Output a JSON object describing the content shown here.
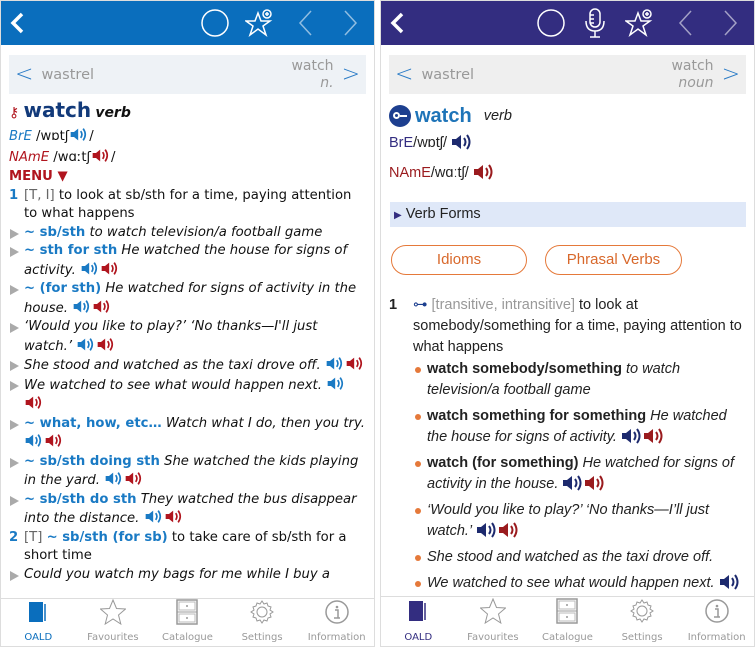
{
  "colors": {
    "left_header": "#0a6ebd",
    "right_header": "#332d80",
    "link_blue": "#1a7ac4",
    "name_red": "#b0151e",
    "accent_orange": "#e5793a"
  },
  "left": {
    "nav": {
      "prev": "wastrel",
      "next_word": "watch",
      "next_pos": "n."
    },
    "headword": "watch",
    "pos": "verb",
    "bre_label": "BrE",
    "bre_pron": "/wɒtʃ",
    "nam_label": "NAmE",
    "nam_pron": "/wɑːtʃ",
    "slash": "/",
    "menu": "MENU ▼",
    "sense1": {
      "num": "1",
      "grammar": "[T, I]",
      "def": "to look at sb/sth for a time, paying attention to what happens"
    },
    "examples": [
      {
        "pattern": "~ sb/sth",
        "text": "to watch television/a football game"
      },
      {
        "pattern": "~ sth for sth",
        "text": "He watched the house for signs of activity."
      },
      {
        "pattern": "~ (for sth)",
        "text": "He watched for signs of activity in the house."
      },
      {
        "pattern": "",
        "text": "‘Would you like to play?’ ‘No thanks—I'll just watch.’"
      },
      {
        "pattern": "",
        "text": "She stood and watched as the taxi drove off."
      },
      {
        "pattern": "",
        "text": "We watched to see what would happen next."
      },
      {
        "pattern": "~ what, how, etc…",
        "text": "Watch what I do, then you try."
      },
      {
        "pattern": "~ sb/sth doing sth",
        "text": "She watched the kids playing in the yard."
      },
      {
        "pattern": "~ sb/sth do sth",
        "text": "They watched the bus disappear into the distance."
      }
    ],
    "sense2": {
      "num": "2",
      "grammar": "[T]",
      "pattern": "~ sb/sth (for sb)",
      "def": "to take care of sb/sth for a short time"
    },
    "sense2_example": "Could you watch my bags for me while I buy a"
  },
  "right": {
    "nav": {
      "prev": "wastrel",
      "next_word": "watch",
      "next_pos": "noun"
    },
    "headword": "watch",
    "pos": "verb",
    "bre_label": "BrE",
    "bre_pron": "/wɒtʃ/",
    "nam_label": "NAmE",
    "nam_pron": "/wɑːtʃ/",
    "verb_forms": "Verb Forms",
    "idioms": "Idioms",
    "phrasal_verbs": "Phrasal Verbs",
    "sense1": {
      "num": "1",
      "grammar": "[transitive, intransitive]",
      "def": "to look at somebody/something for a time, paying attention to what happens"
    },
    "examples": [
      {
        "pattern": "watch somebody/something",
        "text": "to watch television/a football game"
      },
      {
        "pattern": "watch something for something",
        "text": "He watched the house for signs of activity."
      },
      {
        "pattern": "watch (for something)",
        "text": "He watched for signs of activity in the house."
      },
      {
        "pattern": "",
        "text": "‘Would you like to play?’ ‘No thanks—I’ll just watch.’"
      },
      {
        "pattern": "",
        "text": "She stood and watched as the taxi drove off."
      },
      {
        "pattern": "",
        "text": "We watched to see what would happen next."
      }
    ]
  },
  "tabs": [
    "OALD",
    "Favourites",
    "Catalogue",
    "Settings",
    "Information"
  ]
}
